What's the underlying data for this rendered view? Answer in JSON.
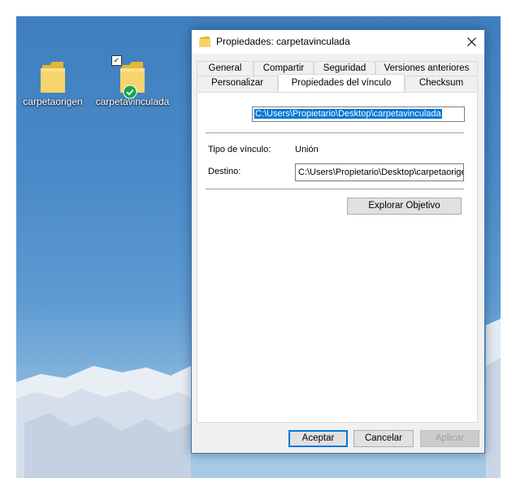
{
  "desktop": {
    "icons": [
      {
        "label": "carpetaorigen"
      },
      {
        "label": "carpetavinculada",
        "check": "✓"
      }
    ]
  },
  "dialog": {
    "title": "Propiedades: carpetavinculada",
    "tabs_row1": [
      "General",
      "Compartir",
      "Seguridad",
      "Versiones anteriores"
    ],
    "tabs_row2": [
      "Personalizar",
      "Propiedades del vínculo",
      "Checksum"
    ],
    "active_tab": "Propiedades del vínculo",
    "path": "C:\\Users\\Propietario\\Desktop\\carpetavinculada",
    "link_type_label": "Tipo de vínculo:",
    "link_type_value": "Unión",
    "destination_label": "Destino:",
    "destination_value": "C:\\Users\\Propietario\\Desktop\\carpetaorigen",
    "browse_button": "Explorar Objetivo",
    "buttons": {
      "ok": "Aceptar",
      "cancel": "Cancelar",
      "apply": "Aplicar"
    }
  },
  "colors": {
    "accent": "#0078d7",
    "border": "#3c79c0",
    "folder": "#f3c84f",
    "badge": "#16a34a"
  }
}
